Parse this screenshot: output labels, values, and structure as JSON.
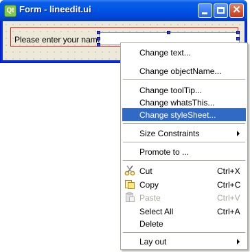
{
  "window": {
    "title": "Form - lineedit.ui",
    "app_icon_text": "Qt"
  },
  "form": {
    "label_text": "Please enter your name:"
  },
  "menu": {
    "items": [
      {
        "label": "Change text..."
      },
      {
        "label": "Change objectName..."
      },
      {
        "label": "Change toolTip..."
      },
      {
        "label": "Change whatsThis..."
      },
      {
        "label": "Change styleSheet...",
        "highlighted": true
      },
      {
        "label": "Size Constraints",
        "submenu": true
      },
      {
        "label": "Promote to ..."
      },
      {
        "label": "Cut",
        "shortcut": "Ctrl+X",
        "icon": "scissors-icon"
      },
      {
        "label": "Copy",
        "shortcut": "Ctrl+C",
        "icon": "copy-icon"
      },
      {
        "label": "Paste",
        "shortcut": "Ctrl+V",
        "icon": "paste-icon",
        "disabled": true
      },
      {
        "label": "Select All",
        "shortcut": "Ctrl+A"
      },
      {
        "label": "Delete"
      },
      {
        "label": "Lay out",
        "submenu": true
      }
    ]
  },
  "colors": {
    "highlight": "#316ac5",
    "titlebar": "#0055e5",
    "selection_border": "#e32020"
  }
}
